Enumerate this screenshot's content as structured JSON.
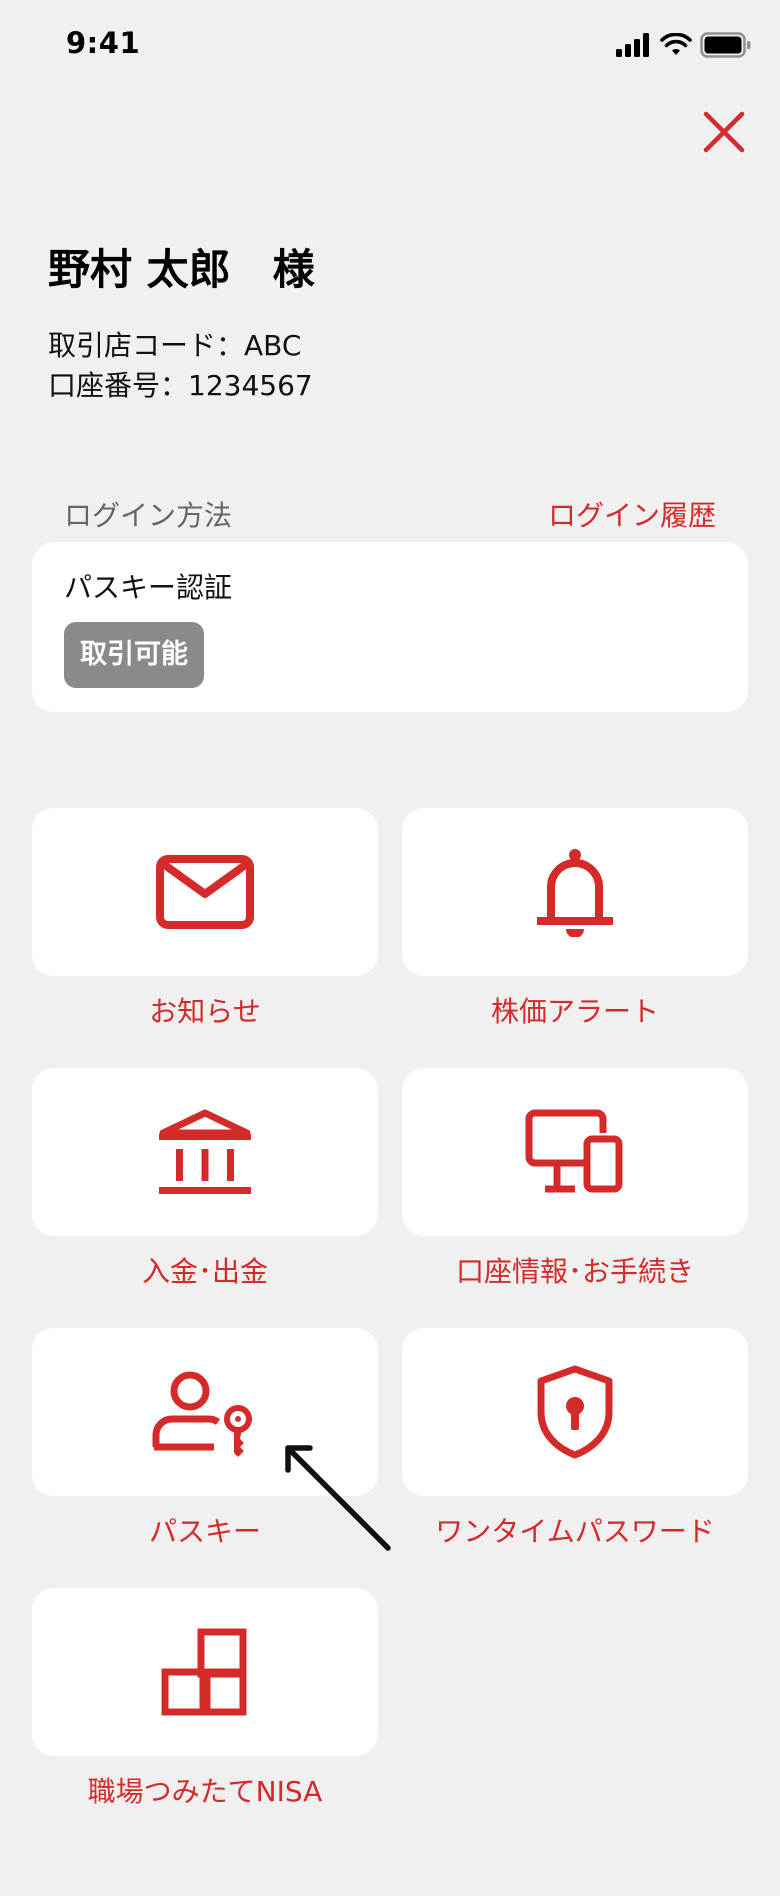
{
  "status_bar": {
    "time": "9:41",
    "icons": [
      "signal-icon",
      "wifi-icon",
      "battery-icon"
    ]
  },
  "header": {
    "close_icon": "close-icon"
  },
  "user": {
    "name": "野村 太郎　様",
    "branch_code": "取引店コード：ABC",
    "account_number": "口座番号：1234567"
  },
  "login": {
    "section_label": "ログイン方法",
    "history_link": "ログイン履歴",
    "method": "パスキー認証",
    "badge": "取引可能"
  },
  "menu": [
    {
      "label": "お知らせ",
      "icon": "mail-icon"
    },
    {
      "label": "株価アラート",
      "icon": "bell-icon"
    },
    {
      "label": "入金･出金",
      "icon": "bank-icon"
    },
    {
      "label": "口座情報･お手続き",
      "icon": "devices-icon"
    },
    {
      "label": "パスキー",
      "icon": "user-key-icon"
    },
    {
      "label": "ワンタイムパスワード",
      "icon": "shield-lock-icon"
    },
    {
      "label": "職場つみたてNISA",
      "icon": "blocks-icon"
    }
  ],
  "colors": {
    "accent": "#d42a2a",
    "background": "#f0f0f0",
    "card": "#ffffff",
    "badge": "#8a8a8a"
  }
}
